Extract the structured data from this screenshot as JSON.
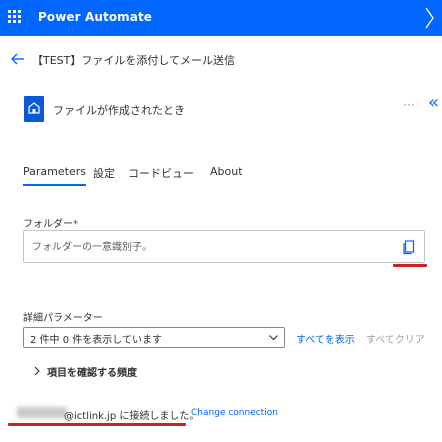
{
  "app": {
    "brand": "Power Automate"
  },
  "flow": {
    "title": "【TEST】ファイルを添付してメール送信"
  },
  "trigger": {
    "name": "ファイルが作成されたとき",
    "more_glyph": "···",
    "collapse_glyph": "«"
  },
  "tabs": [
    {
      "label": "Parameters",
      "active": true
    },
    {
      "label": "設定",
      "active": false
    },
    {
      "label": "コードビュー",
      "active": false
    },
    {
      "label": "About",
      "active": false
    }
  ],
  "folder": {
    "label": "フォルダー",
    "required_mark": "*",
    "value": "",
    "placeholder": "フォルダーの一意識別子。"
  },
  "advanced": {
    "label": "詳細パラメーター",
    "selected": "2 件中 0 件を表示しています",
    "show_all": "すべてを表示",
    "clear_all": "すべてクリア"
  },
  "frequency": {
    "label": "項目を確認する頻度"
  },
  "connection": {
    "text": "@ictlink.jp に接続しました。",
    "change_label": "Change connection"
  },
  "colors": {
    "accent": "#0066ff",
    "header_bg": "#0066ff",
    "trigger_icon": "#0a5ad6",
    "annotation_red": "#d11f1f"
  },
  "icons": {
    "waffle": "waffle-icon",
    "back": "back-arrow-icon",
    "trigger": "onedrive-file-icon",
    "folder_picker": "folder-picker-icon",
    "dropdown": "chevron-down-icon",
    "expand": "chevron-right-icon"
  }
}
